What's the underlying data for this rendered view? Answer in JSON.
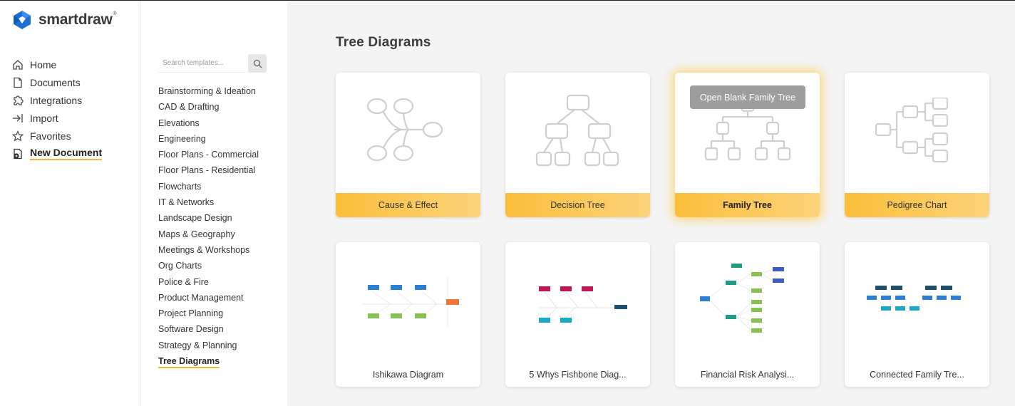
{
  "app": {
    "logo_text": "smartdraw",
    "logo_mark": "®"
  },
  "nav": {
    "items": [
      {
        "label": "Home",
        "icon": "home-icon"
      },
      {
        "label": "Documents",
        "icon": "document-icon"
      },
      {
        "label": "Integrations",
        "icon": "puzzle-icon"
      },
      {
        "label": "Import",
        "icon": "import-icon"
      },
      {
        "label": "Favorites",
        "icon": "star-icon"
      },
      {
        "label": "New Document",
        "icon": "new-document-icon"
      }
    ],
    "active": "New Document"
  },
  "search": {
    "placeholder": "Search templates..."
  },
  "categories": [
    "Brainstorming & Ideation",
    "CAD & Drafting",
    "Elevations",
    "Engineering",
    "Floor Plans - Commercial",
    "Floor Plans - Residential",
    "Flowcharts",
    "IT & Networks",
    "Landscape Design",
    "Maps & Geography",
    "Meetings & Workshops",
    "Org Charts",
    "Police & Fire",
    "Product Management",
    "Project Planning",
    "Software Design",
    "Strategy & Planning",
    "Tree Diagrams"
  ],
  "active_category": "Tree Diagrams",
  "main": {
    "title": "Tree Diagrams",
    "blank_templates": [
      {
        "label": "Cause & Effect",
        "icon": "cause-effect-icon"
      },
      {
        "label": "Decision Tree",
        "icon": "decision-tree-icon"
      },
      {
        "label": "Family Tree",
        "icon": "family-tree-icon",
        "hover_button": "Open Blank Family Tree"
      },
      {
        "label": "Pedigree Chart",
        "icon": "pedigree-chart-icon"
      }
    ],
    "examples": [
      {
        "label": "Ishikawa Diagram"
      },
      {
        "label": "5 Whys Fishbone Diag..."
      },
      {
        "label": "Financial Risk Analysi..."
      },
      {
        "label": "Connected Family Tre..."
      }
    ]
  },
  "colors": {
    "accent": "#f5b72e",
    "card_label_start": "#fbbe3a",
    "card_label_end": "#fcd37a",
    "icon_stroke": "#c8c8c8"
  }
}
